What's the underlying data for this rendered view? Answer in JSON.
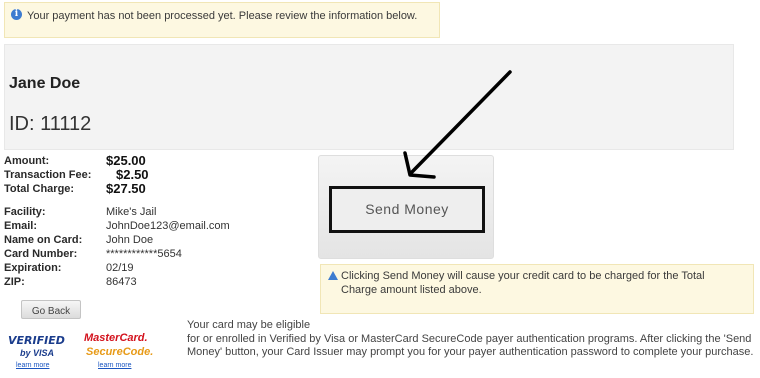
{
  "notice": {
    "text": "Your payment has not been processed yet. Please review the information below."
  },
  "customer": {
    "name": "Jane Doe",
    "id_label": "ID: 11112"
  },
  "details": {
    "amount_label": "Amount:",
    "amount_value": "$25.00",
    "fee_label": "Transaction Fee:",
    "fee_value": "$2.50",
    "total_label": "Total Charge:",
    "total_value": "$27.50",
    "facility_label": "Facility:",
    "facility_value": "Mike's Jail",
    "email_label": "Email:",
    "email_value": "JohnDoe123@email.com",
    "card_name_label": "Name on Card:",
    "card_name_value": "John Doe",
    "card_number_label": "Card Number:",
    "card_number_value": "************5654",
    "expiration_label": "Expiration:",
    "expiration_value": "02/19",
    "zip_label": "ZIP:",
    "zip_value": "86473"
  },
  "buttons": {
    "go_back": "Go Back",
    "send_money": "Send Money"
  },
  "warning": {
    "text": "Clicking Send Money will cause your credit card to be charged for the Total Charge amount listed above."
  },
  "logos": {
    "verified_line1": "VERIFIED",
    "verified_line2": "by VISA",
    "verified_learn": "learn more",
    "mastercard_line1": "MasterCard.",
    "mastercard_line2": "SecureCode.",
    "mastercard_learn": "learn more"
  },
  "auth": {
    "line1": "Your card may be eligible",
    "line2": "for or enrolled in Verified by Visa or MasterCard SecureCode payer authentication programs. After clicking the 'Send Money' button, your Card Issuer may prompt you for your payer authentication password to complete your purchase."
  },
  "colors": {
    "notice_bg": "#fdf8e1",
    "info_icon": "#3d7cd0",
    "visa_blue": "#1a3c8c",
    "mastercard_red": "#d3121d",
    "mastercard_orange": "#e79a17"
  }
}
